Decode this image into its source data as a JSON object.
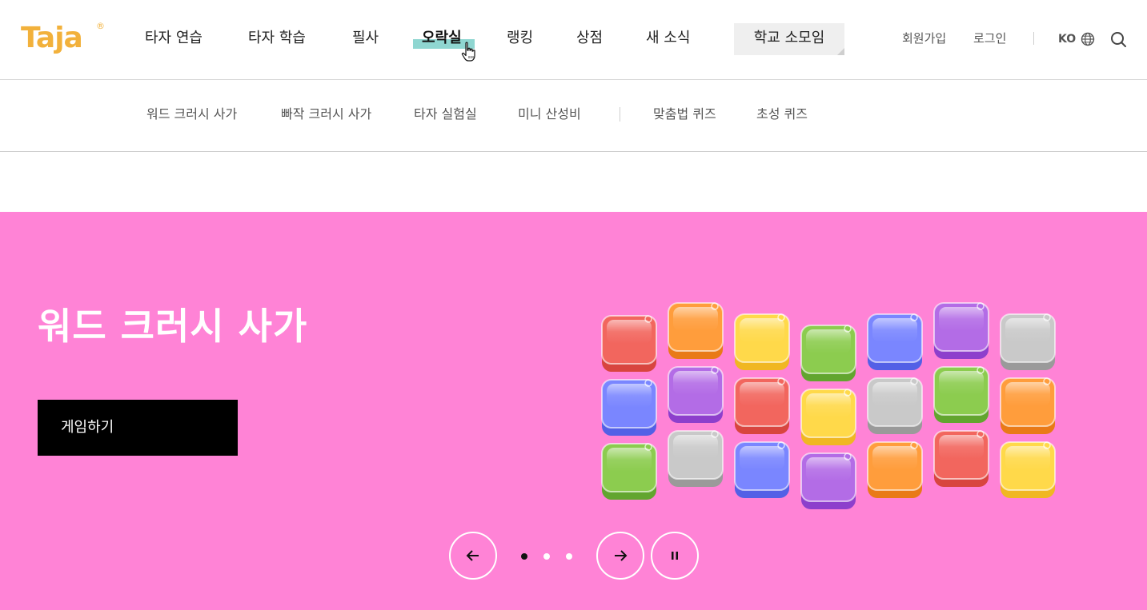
{
  "brand": {
    "logo_text": "Taja",
    "logo_mark": "®",
    "color": "#f2b13b"
  },
  "gnb": {
    "items": [
      {
        "label": "타자 연습"
      },
      {
        "label": "타자 학습"
      },
      {
        "label": "필사"
      },
      {
        "label": "오락실",
        "active": true
      },
      {
        "label": "랭킹"
      },
      {
        "label": "상점"
      },
      {
        "label": "새 소식"
      },
      {
        "label": "학교 소모임"
      }
    ],
    "highlight_color": "#8fd6d1"
  },
  "util": {
    "signup": "회원가입",
    "login": "로그인",
    "lang": "KO"
  },
  "subnav": {
    "items": [
      {
        "label": "워드 크러시 사가"
      },
      {
        "label": "빠작 크러시 사가"
      },
      {
        "label": "타자 실험실"
      },
      {
        "label": "미니 산성비"
      },
      {
        "label": "맞춤법 퀴즈"
      },
      {
        "label": "초성 퀴즈"
      }
    ]
  },
  "hero": {
    "title": "워드 크러시 사가",
    "button_label": "게임하기",
    "background": "#ff83d6",
    "slides": {
      "count": 3,
      "current": 1
    }
  },
  "icons": {
    "search": "search-icon",
    "globe": "globe-icon",
    "prev": "arrow-left-icon",
    "next": "arrow-right-icon",
    "pause": "pause-icon",
    "cursor": "hand-pointer-icon"
  }
}
